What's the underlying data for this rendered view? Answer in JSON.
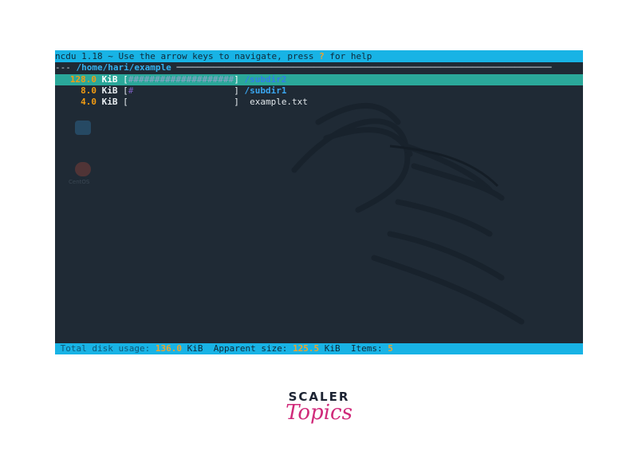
{
  "terminal": {
    "topbar": {
      "prefix": "ncdu 1.18 ~ Use the arrow keys to navigate, press ",
      "help_key": "?",
      "suffix": " for help"
    },
    "pathbar": {
      "lead": "--- ",
      "path": "/home/hari/example",
      "trail": " ───────────────────────────────────────────────────────────────────────"
    },
    "items": [
      {
        "size": "128.0",
        "unit": "KiB",
        "bar_open": " [",
        "hashes": "####################",
        "bar_pad": "",
        "bar_close": "] ",
        "name": "/subdir2",
        "kind": "dir",
        "selected": true
      },
      {
        "size": "8.0",
        "unit": "KiB",
        "bar_open": " [",
        "hashes": "#",
        "bar_pad": "                   ",
        "bar_close": "] ",
        "name": "/subdir1",
        "kind": "dir",
        "selected": false
      },
      {
        "size": "4.0",
        "unit": "KiB",
        "bar_open": " [",
        "hashes": "",
        "bar_pad": "                    ",
        "bar_close": "]  ",
        "name": "example.txt",
        "kind": "file",
        "selected": false
      }
    ],
    "desktop": {
      "icons": [
        {
          "name": "home-folder-icon",
          "color": "#3aa6f0"
        },
        {
          "name": "geeks-icon",
          "color": "#e5533d",
          "label": "CentOS"
        }
      ]
    },
    "statusbar": {
      "total_label": "Total disk usage: ",
      "total_value": "136.0",
      "total_unit": " KiB  ",
      "apparent_label": "Apparent size: ",
      "apparent_value": "125.5",
      "apparent_unit": " KiB  ",
      "items_label": "Items: ",
      "items_value": "5"
    }
  },
  "branding": {
    "line1": "SCALER",
    "line2": "Topics",
    "accent": "#d02a7a"
  }
}
